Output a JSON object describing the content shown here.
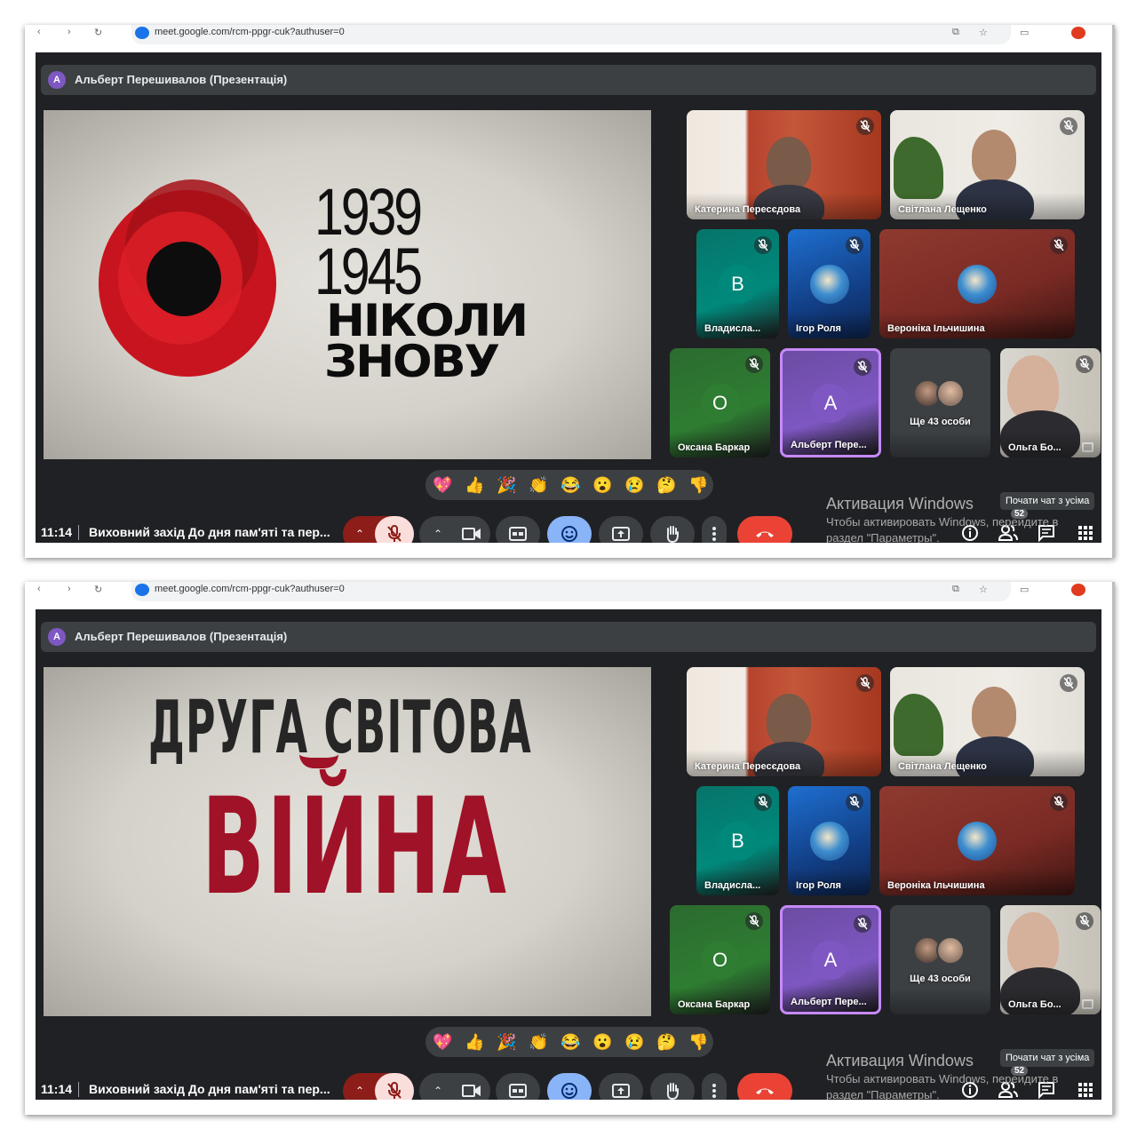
{
  "screens": [
    {
      "slide_kind": "poppy",
      "slide": {
        "year_start": "1939",
        "year_end": "1945",
        "word1": "НІКОЛИ",
        "word2": "ЗНОВУ"
      }
    },
    {
      "slide_kind": "war",
      "slide": {
        "line1": "ДРУГА  СВІТОВА",
        "line2": "ВІЙНА"
      }
    }
  ],
  "browser": {
    "url": "meet.google.com/rcm-ppgr-cuk?authuser=0"
  },
  "presenter": {
    "initial": "A",
    "label": "Альберт Перешивалов (Презентація)"
  },
  "participants": [
    {
      "name": "Катерина Пересєдова",
      "type": "video"
    },
    {
      "name": "Світлана Лещенко",
      "type": "video"
    },
    {
      "name": "Владисла...",
      "type": "letter",
      "letter": "В",
      "color": "#00897b"
    },
    {
      "name": "Ігор Роля",
      "type": "image"
    },
    {
      "name": "Вероніка Ільчишина",
      "type": "image"
    },
    {
      "name": "Оксана Баркар",
      "type": "letter",
      "letter": "О",
      "color": "#2e7d32"
    },
    {
      "name": "Альберт Пере...",
      "type": "letter",
      "letter": "А",
      "color": "#7e57c2"
    },
    {
      "name": "Ще 43 особи",
      "type": "group"
    },
    {
      "name": "Ольга Бо...",
      "type": "video"
    }
  ],
  "reactions": [
    "💖",
    "👍",
    "🎉",
    "👏",
    "😂",
    "😮",
    "😢",
    "🤔",
    "👎"
  ],
  "meeting": {
    "time": "11:14",
    "title": "Виховний захід До дня пам'яті та пер..."
  },
  "windows_activation": {
    "title": "Активация Windows",
    "line1": "Чтобы активировать Windows, перейдите в",
    "line2": "раздел \"Параметры\"."
  },
  "tooltip": "Почати чат з усіма",
  "people_count": "52",
  "colors": {
    "meet_bg": "#202124",
    "tile_bg": "#3c4043",
    "end_call": "#ea4335",
    "active": "#8ab4f8",
    "speaking": "#c58af9"
  }
}
